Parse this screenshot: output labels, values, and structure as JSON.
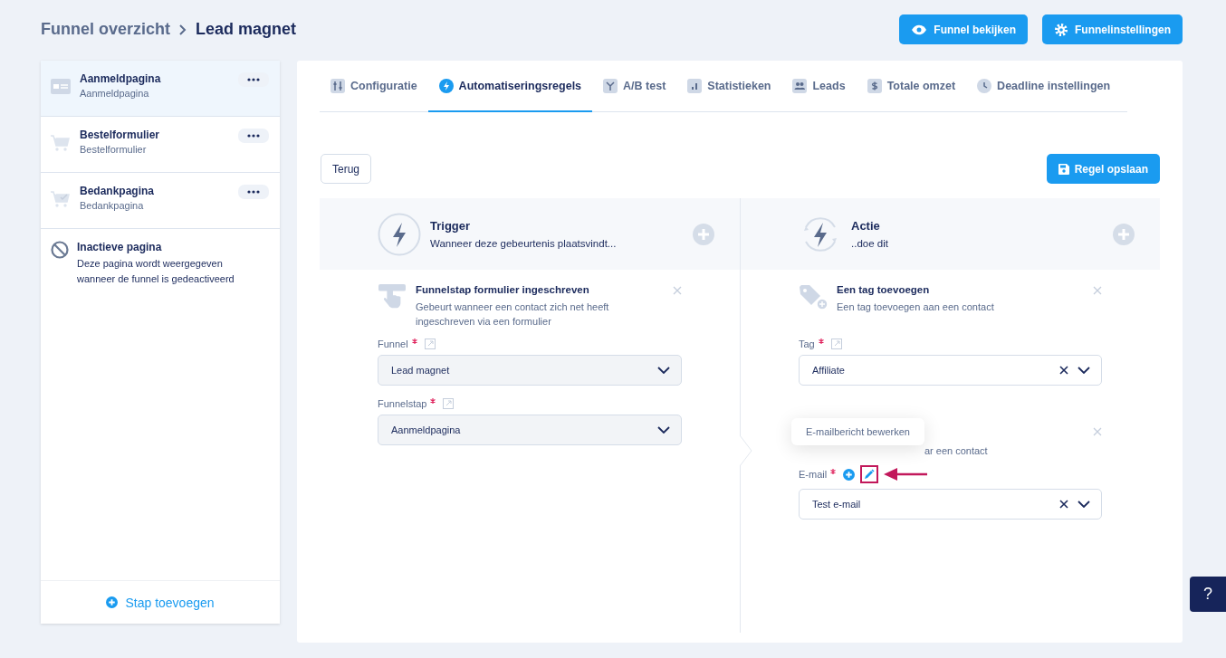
{
  "breadcrumb": [
    {
      "label": "Funnel overzicht"
    },
    {
      "label": "Lead magnet"
    }
  ],
  "header_buttons": [
    {
      "label": "Funnel bekijken",
      "kind": "eye"
    },
    {
      "label": "Funnelinstellingen",
      "kind": "gear"
    }
  ],
  "sidebar": {
    "pages": [
      {
        "title": "Aanmeldpagina",
        "subtitle": "Aanmeldpagina",
        "kind": "form",
        "selected": true
      },
      {
        "title": "Bestelformulier",
        "subtitle": "Bestelformulier",
        "kind": "cart",
        "selected": false
      },
      {
        "title": "Bedankpagina",
        "subtitle": "Bedankpagina",
        "kind": "cart-check",
        "selected": false
      }
    ],
    "inactive": {
      "title": "Inactieve pagina",
      "description": "Deze pagina wordt weergegeven wanneer de funnel is gedeactiveerd"
    },
    "add_button": "Stap toevoegen"
  },
  "tabs": [
    {
      "label": "Configuratie",
      "kind": "sliders",
      "selected": false
    },
    {
      "label": "Automatiseringsregels",
      "kind": "bolt",
      "selected": true
    },
    {
      "label": "A/B test",
      "kind": "split",
      "selected": false
    },
    {
      "label": "Statistieken",
      "kind": "chart",
      "selected": false
    },
    {
      "label": "Leads",
      "kind": "people",
      "selected": false
    },
    {
      "label": "Totale omzet",
      "kind": "dollar",
      "selected": false
    },
    {
      "label": "Deadline instellingen",
      "kind": "clock",
      "selected": false
    }
  ],
  "back_button": "Terug",
  "save_button": "Regel opslaan",
  "trigger": {
    "title": "Trigger",
    "subtitle": "Wanneer deze gebeurtenis plaatsvindt...",
    "step": {
      "title": "Funnelstap formulier ingeschreven",
      "description": "Gebeurt wanneer een contact zich net heeft ingeschreven via een formulier",
      "fields": [
        {
          "label": "Funnel",
          "required": true,
          "value": "Lead magnet"
        },
        {
          "label": "Funnelstap",
          "required": true,
          "value": "Aanmeldpagina"
        }
      ]
    }
  },
  "action": {
    "title": "Actie",
    "subtitle": "..doe dit",
    "steps": [
      {
        "kind": "tag",
        "title": "Een tag toevoegen",
        "description": "Een tag toevoegen aan een contact",
        "field": {
          "label": "Tag",
          "required": true,
          "value": "Affiliate",
          "clearable": true
        }
      },
      {
        "kind": "email",
        "description": "ar een contact",
        "field": {
          "label": "E-mail",
          "required": true,
          "value": "Test e-mail",
          "clearable": true
        }
      }
    ]
  },
  "tooltip": "E-mailbericht bewerken",
  "help_button": "?"
}
